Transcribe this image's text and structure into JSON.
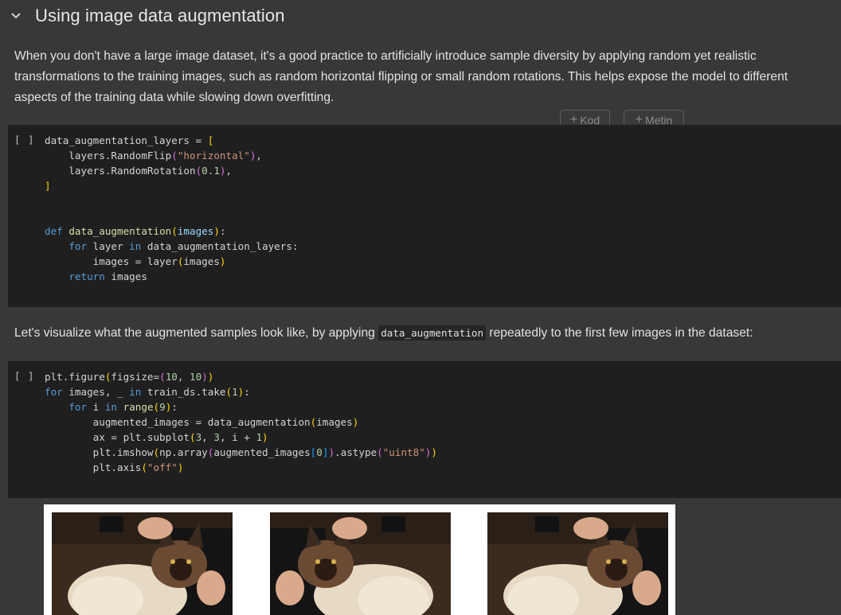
{
  "section": {
    "title": "Using image data augmentation"
  },
  "text_cell_1": {
    "text": "When you don't have a large image dataset, it's a good practice to artificially introduce sample diversity by applying random yet realistic transformations to the training images, such as random horizontal flipping or small random rotations. This helps expose the model to different aspects of the training data while slowing down overfitting."
  },
  "hover_buttons": {
    "code_label": "Kod",
    "text_label": "Metin"
  },
  "code_cell_1": {
    "run_indicator": "[ ]"
  },
  "text_cell_2": {
    "before": "Let's visualize what the augmented samples look like, by applying ",
    "code": "data_augmentation",
    "after": " repeatedly to the first few images in the dataset:"
  },
  "code_cell_2": {
    "run_indicator": "[ ]"
  },
  "output": {
    "image_count": 3
  }
}
